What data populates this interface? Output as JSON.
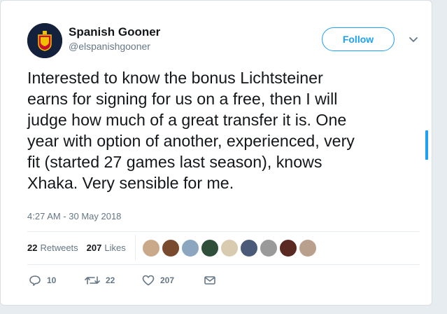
{
  "author": {
    "display_name": "Spanish Gooner",
    "handle": "@elspanishgooner"
  },
  "follow_label": "Follow",
  "tweet": {
    "lines": [
      "Interested to know the bonus Lichtsteiner",
      "earns for signing for us on a free, then I will",
      "judge how much of a great transfer it is. One",
      "year with option of another, experienced, very",
      "fit (started 27 games last season), knows",
      "Xhaka. Very sensible for me."
    ],
    "timestamp": "4:27 AM - 30 May 2018"
  },
  "stats": {
    "retweets_count": "22",
    "retweets_label": "Retweets",
    "likes_count": "207",
    "likes_label": "Likes"
  },
  "actions": {
    "reply_count": "10",
    "retweet_count": "22",
    "like_count": "207"
  },
  "colors": {
    "accent": "#1da1f2",
    "text": "#14171a",
    "muted": "#657786"
  },
  "liker_avatar_colors": [
    "#c9a98a",
    "#7a4a2e",
    "#8da6c0",
    "#2f4f3a",
    "#d8cbb0",
    "#4a5a78",
    "#9a9a9a",
    "#5a2a22",
    "#b8a08c"
  ]
}
